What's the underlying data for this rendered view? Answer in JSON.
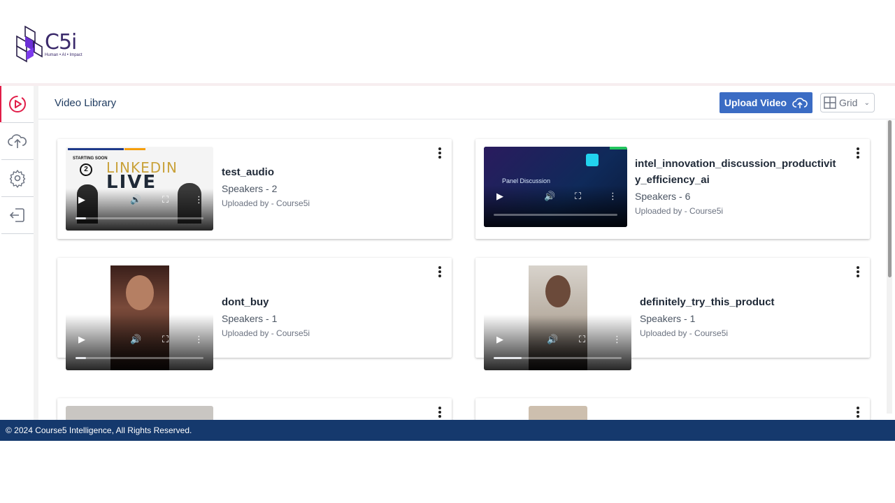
{
  "brand": {
    "name": "C5i",
    "tagline": "Human • AI • Impact"
  },
  "sidebar": {
    "items": [
      {
        "name": "video-library",
        "icon": "play-circle-icon",
        "active": true
      },
      {
        "name": "upload",
        "icon": "cloud-upload-icon",
        "active": false
      },
      {
        "name": "settings",
        "icon": "gear-icon",
        "active": false
      },
      {
        "name": "logout",
        "icon": "logout-icon",
        "active": false
      }
    ]
  },
  "header": {
    "title": "Video Library",
    "upload_label": "Upload Video",
    "view_label": "Grid"
  },
  "videos": [
    {
      "title": "test_audio",
      "speakers": "Speakers - 2",
      "uploader": "Uploaded by - Course5i",
      "progress": 0.08
    },
    {
      "title": "intel_innovation_discussion_productivity_efficiency_ai",
      "speakers": "Speakers - 6",
      "uploader": "Uploaded by - Course5i",
      "progress": 0.0
    },
    {
      "title": "dont_buy",
      "speakers": "Speakers - 1",
      "uploader": "Uploaded by - Course5i",
      "progress": 0.08
    },
    {
      "title": "definitely_try_this_product",
      "speakers": "Speakers - 1",
      "uploader": "Uploaded by - Course5i",
      "progress": 0.22
    }
  ],
  "thumb_text": {
    "starting_soon": "STARTING SOON",
    "linkedin": "LINKEDIN",
    "live": "LIVE",
    "panel": "Panel Discussion"
  },
  "footer": {
    "copyright": "© 2024 Course5 Intelligence, All Rights Reserved."
  },
  "colors": {
    "primary": "#3b6cc4",
    "footer": "#15396d",
    "active": "#e11d48"
  }
}
